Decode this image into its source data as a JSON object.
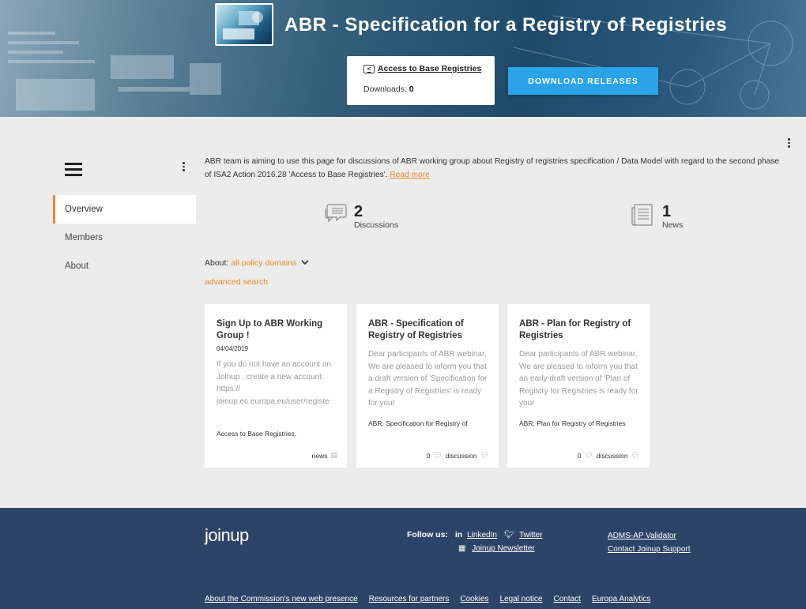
{
  "header": {
    "title": "ABR - Specification for a Registry of Registries",
    "collection_link": "Access to Base Registries",
    "downloads_label": "Downloads:",
    "downloads_count": "0",
    "download_button": "DOWNLOAD RELEASES"
  },
  "sidebar": {
    "items": [
      {
        "label": "Overview",
        "active": true
      },
      {
        "label": "Members"
      },
      {
        "label": "About"
      }
    ]
  },
  "main": {
    "description": "ABR team is aiming to use this page for discussions of ABR working group about Registry of registries specification / Data Model with regard to the second phase of ISA2 Action 2016.28 'Access to Base Registries'.",
    "read_more": "Read more",
    "stats": {
      "discussions_count": "2",
      "discussions_label": "Discussions",
      "news_count": "1",
      "news_label": "News"
    },
    "filter": {
      "about_label": "About:",
      "about_value": "all policy domains",
      "advanced_search": "advanced search"
    },
    "cards": [
      {
        "title": "Sign Up to ABR Working Group !",
        "date": "04/04/2019",
        "body": "If you do not have an account on Joinup , create a new account: https:// joinup.ec.europa.eu/user/registe",
        "tags": "Access to Base Registries,",
        "count": "",
        "type": "news"
      },
      {
        "title": "ABR - Specification of Registry of Registries",
        "date": "",
        "body": "Dear participants of ABR webinar, We are pleased to inform you that a draft version of 'Specification for a Registry of Registries' is ready for your",
        "tags": "ABR, Specification for Registry of",
        "count": "0",
        "type": "discussion"
      },
      {
        "title": "ABR - Plan for Registry of Registries",
        "date": "",
        "body": "Dear participants of ABR webinar, We are pleased to inform you that an early draft version of 'Plan of Registry for Registries is ready for your",
        "tags": "ABR, Plan for Registry of Registries",
        "count": "0",
        "type": "discussion"
      }
    ]
  },
  "footer": {
    "brand": "joinup",
    "follow_label": "Follow us:",
    "linkedin": "LinkedIn",
    "twitter": "Twitter",
    "newsletter": "Joinup Newsletter",
    "adms_validator": "ADMS-AP Validator",
    "contact_support": "Contact Joinup Support",
    "bottom_links": [
      "About the Commission's new web presence",
      "Resources for partners",
      "Cookies",
      "Legal notice",
      "Contact",
      "Europa Analytics"
    ]
  },
  "colors": {
    "accent_orange": "#f08a24",
    "button_blue": "#2aa3e8",
    "footer_navy": "#2d4468"
  },
  "icons": [
    "kebab-menu-icon",
    "hamburger-menu-icon",
    "discussion-bubble-icon",
    "news-document-icon",
    "chevron-down-icon",
    "linkedin-icon",
    "twitter-icon",
    "newsletter-icon",
    "collection-icon"
  ]
}
